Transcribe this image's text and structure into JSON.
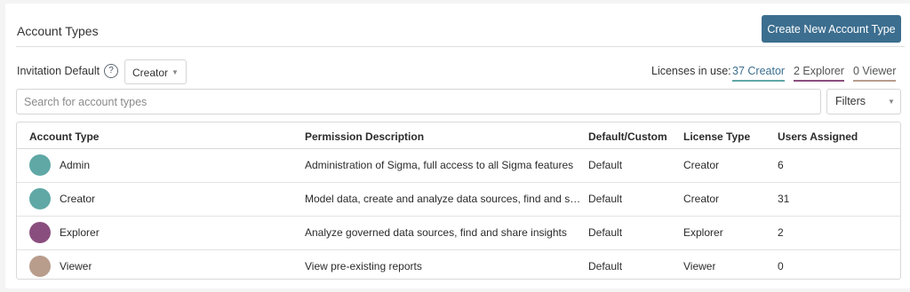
{
  "header": {
    "title": "Account Types",
    "create_button": "Create New Account Type"
  },
  "invitation": {
    "label": "Invitation Default",
    "help_glyph": "?",
    "selected": "Creator"
  },
  "licenses": {
    "label": "Licenses in use:",
    "creator": "37 Creator",
    "explorer": "2 Explorer",
    "viewer": "0 Viewer"
  },
  "search": {
    "placeholder": "Search for account types"
  },
  "filters": {
    "label": "Filters"
  },
  "table": {
    "columns": [
      "Account Type",
      "Permission Description",
      "Default/Custom",
      "License Type",
      "Users Assigned"
    ],
    "rows": [
      {
        "name": "Admin",
        "description": "Administration of Sigma, full access to all Sigma features",
        "default_custom": "Default",
        "license": "Creator",
        "users": "6",
        "color": "#5fa8a6"
      },
      {
        "name": "Creator",
        "description": "Model data, create and analyze data sources, find and share insights",
        "default_custom": "Default",
        "license": "Creator",
        "users": "31",
        "color": "#5fa8a6"
      },
      {
        "name": "Explorer",
        "description": "Analyze governed data sources, find and share insights",
        "default_custom": "Default",
        "license": "Explorer",
        "users": "2",
        "color": "#8a4e7e"
      },
      {
        "name": "Viewer",
        "description": "View pre-existing reports",
        "default_custom": "Default",
        "license": "Viewer",
        "users": "0",
        "color": "#b89c8c"
      }
    ]
  },
  "colors": {
    "primary": "#3c6e8f",
    "creator": "#5fa8a6",
    "explorer": "#8a4e7e",
    "viewer": "#b89c8c"
  }
}
